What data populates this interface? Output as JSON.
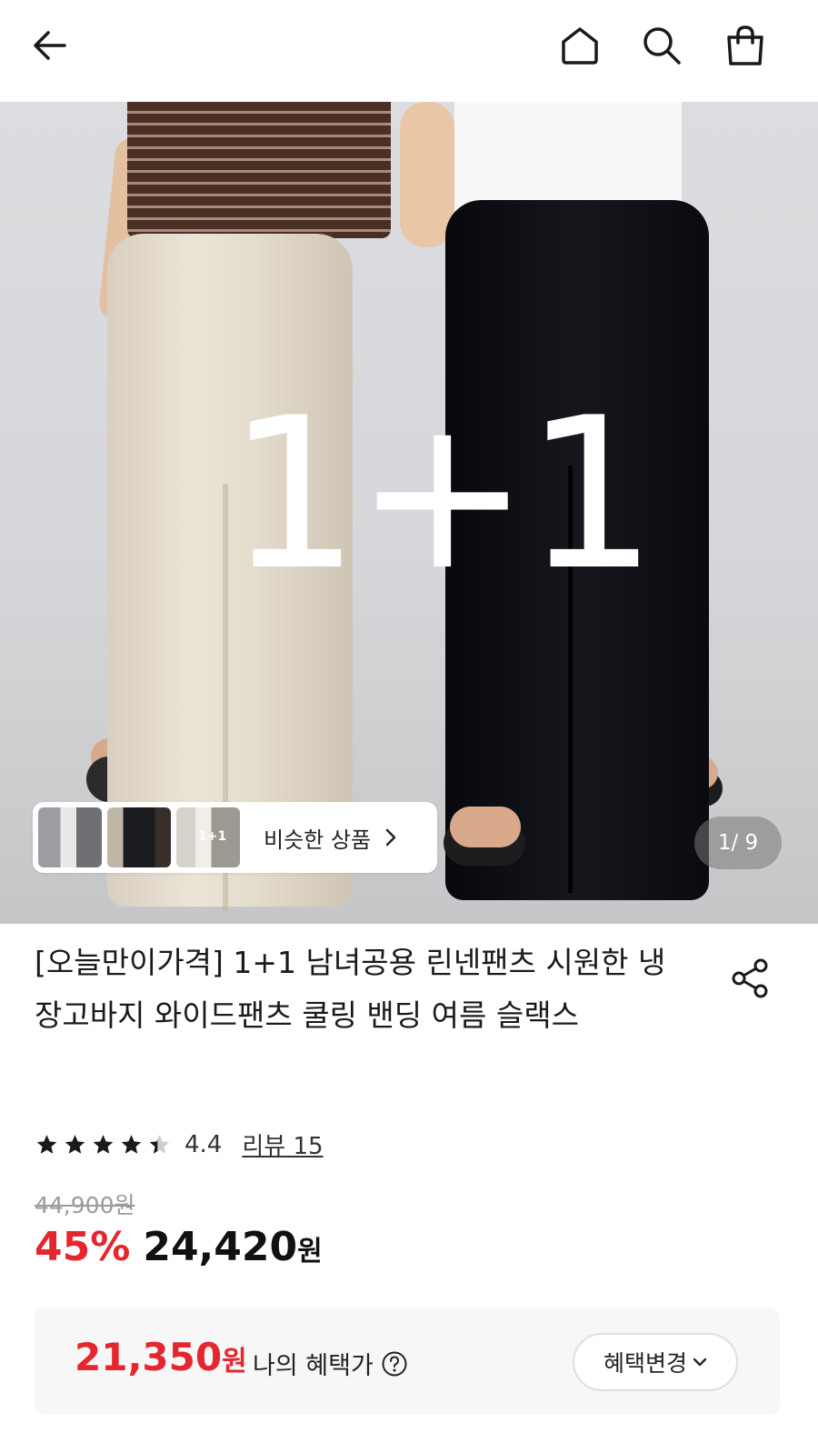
{
  "header": {
    "back_icon": "arrow-left-icon",
    "home_icon": "home-icon",
    "search_icon": "search-icon",
    "cart_icon": "shopping-bag-icon"
  },
  "hero": {
    "promo_text": "1+1",
    "similar_label": "비슷한 상품",
    "thumbnail_3_overlay": "1+1",
    "image_counter": "1/ 9"
  },
  "product": {
    "title": "[오늘만이가격] 1+1 남녀공용 린넨팬츠 시원한 냉장고바지 와이드팬츠 쿨링 밴딩 여름 슬랙스",
    "share_icon": "share-icon",
    "rating": 4.4,
    "rating_text": "4.4",
    "review_text": "리뷰 15",
    "original_price": "44,900원",
    "discount": "45%",
    "sale_price": "24,420",
    "sale_unit": "원"
  },
  "benefit": {
    "price": "21,350",
    "unit": "원",
    "label": "나의 혜택가",
    "button_label": "혜택변경"
  },
  "colors": {
    "accent_red": "#e5262e",
    "text": "#111111"
  }
}
